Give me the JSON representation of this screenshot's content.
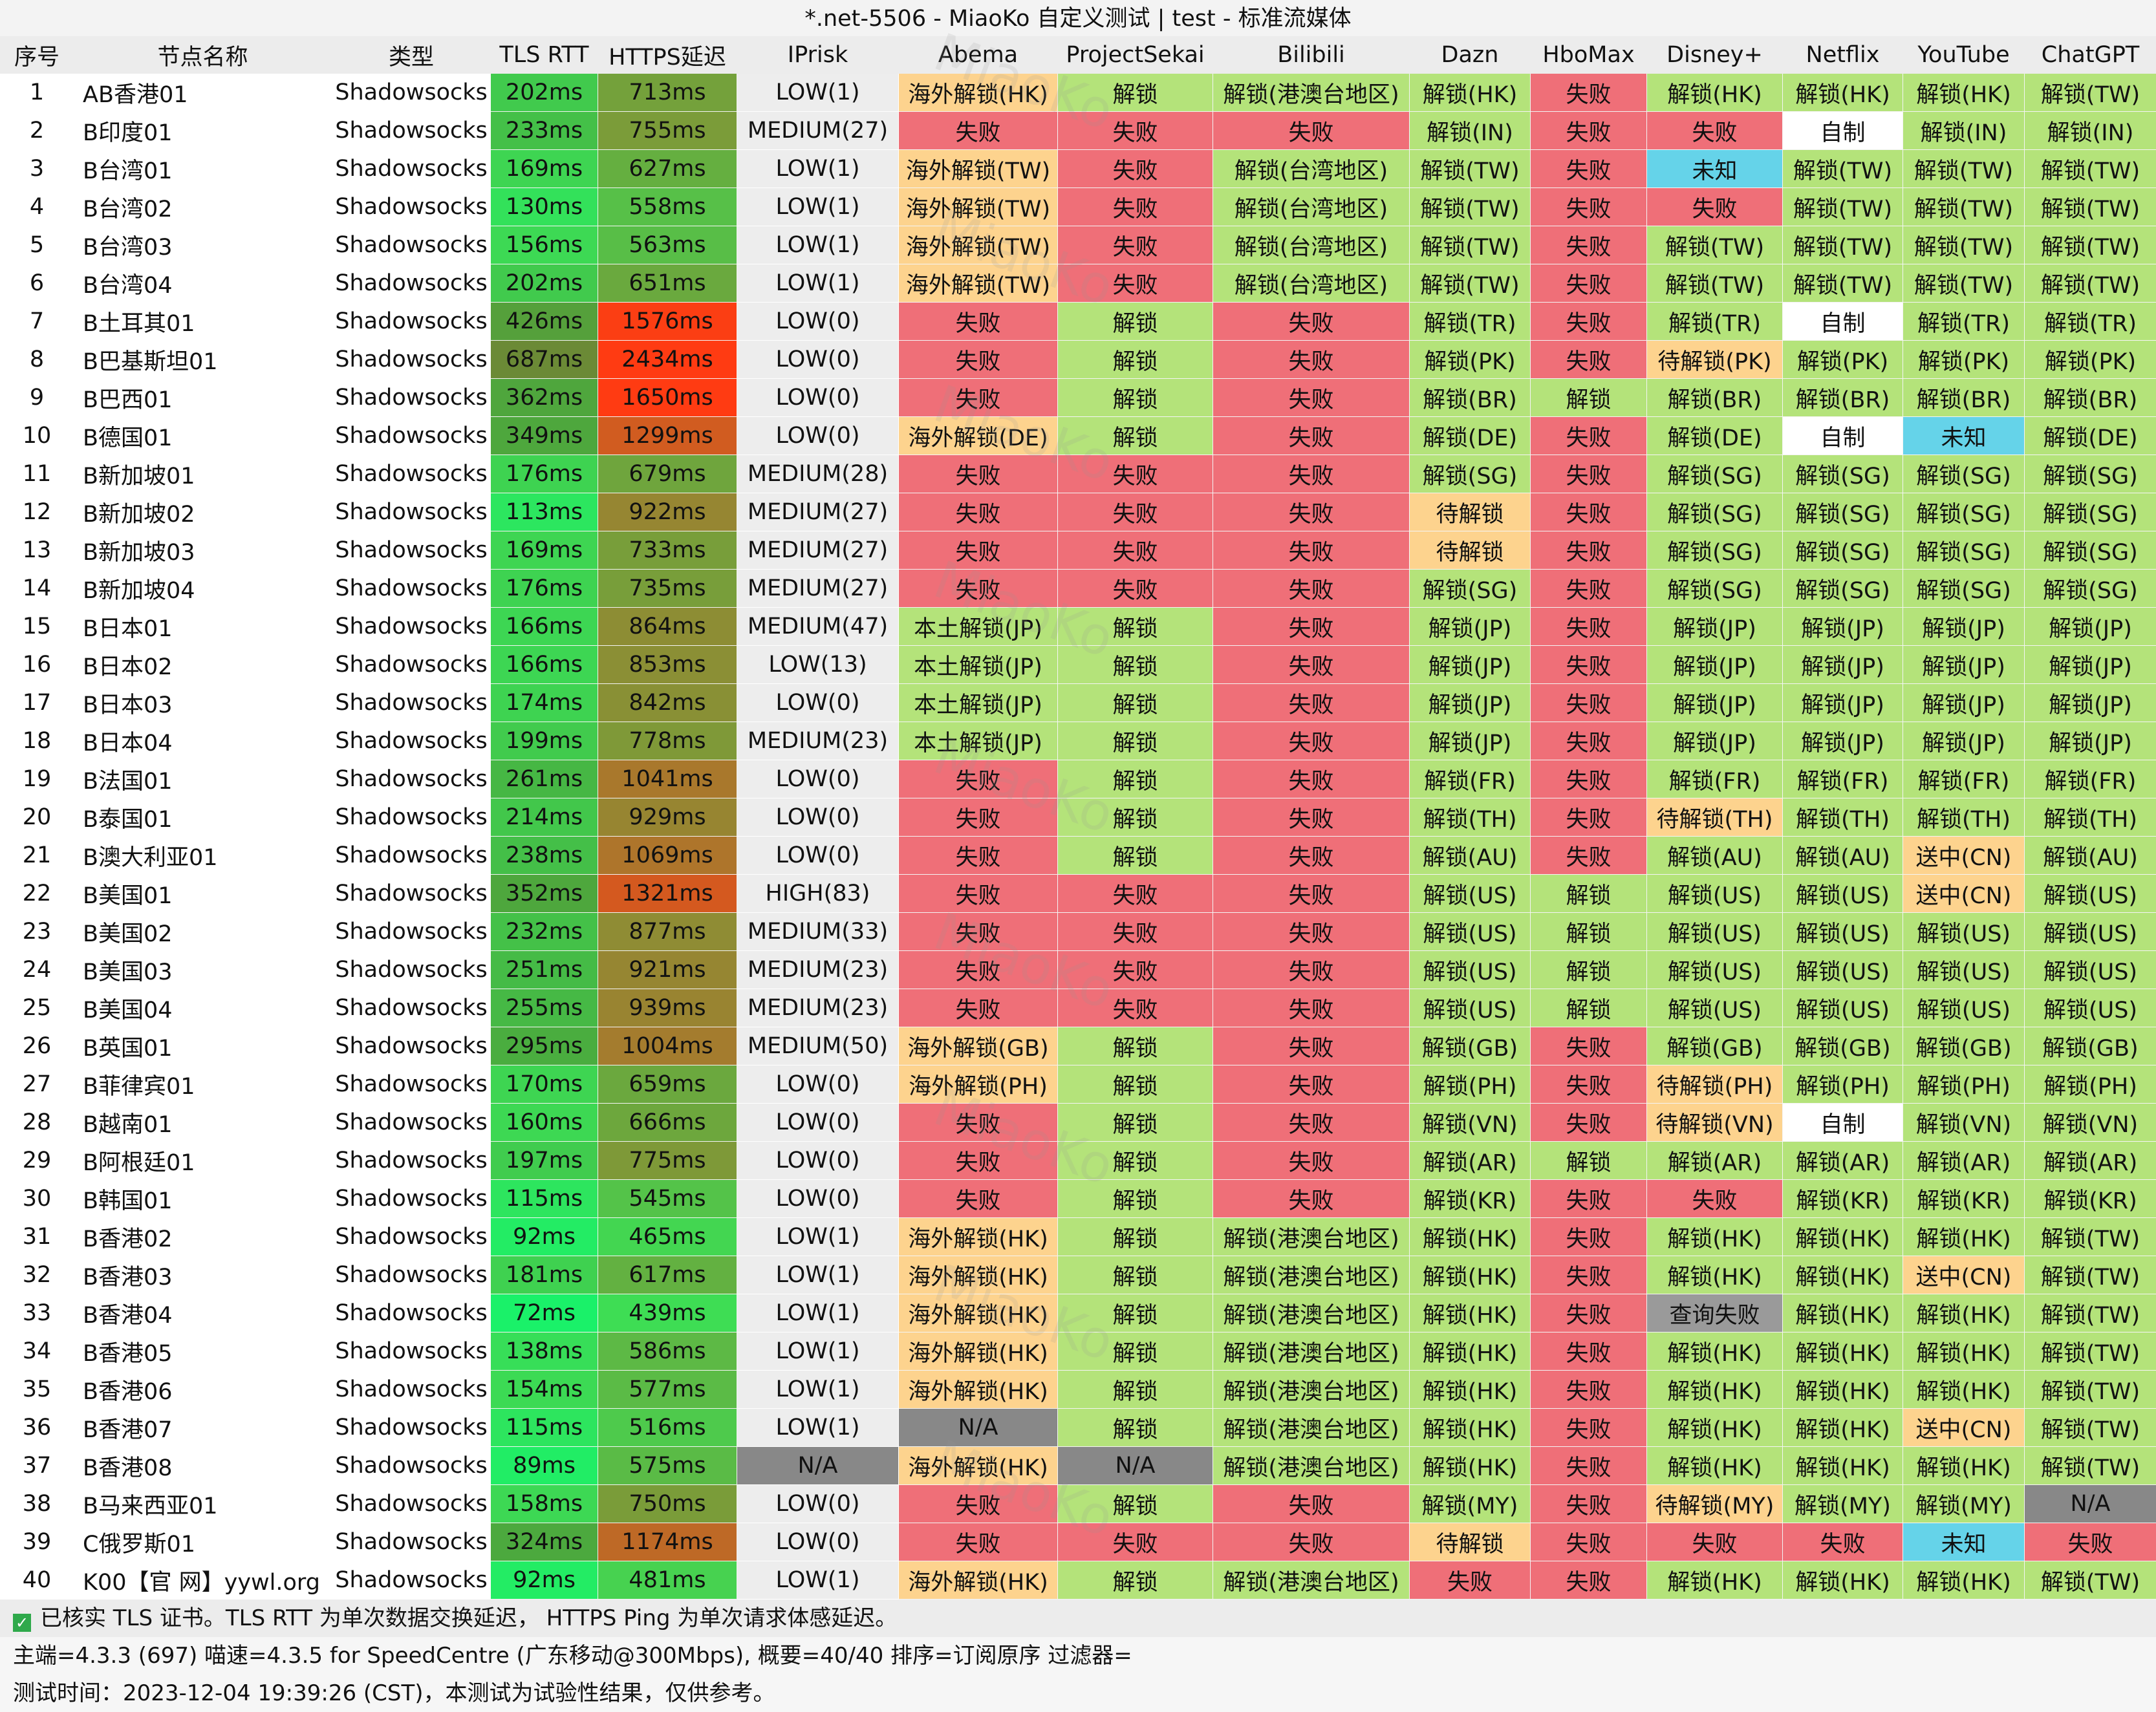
{
  "title": "*.net-5506 - MiaoKo 自定义测试 | test - 标准流媒体",
  "watermark": "MiaoKo",
  "headers": [
    "序号",
    "节点名称",
    "类型",
    "TLS RTT",
    "HTTPS延迟",
    "IPrisk",
    "Abema",
    "ProjectSekai",
    "Bilibili",
    "Dazn",
    "HboMax",
    "Disney+",
    "Netflix",
    "YouTube",
    "ChatGPT"
  ],
  "colors": {
    "unlock": "#b4e37a",
    "fail": "#ef6f78",
    "overseas": "#fdd38e",
    "pending": "#fdd38e",
    "unknown": "#65d3e9",
    "selfmade": "#ffffff",
    "na": "#888888",
    "query_fail": "#9a9a9a"
  },
  "rows": [
    [
      "1",
      "AB香港01",
      "Shadowsocks",
      "202ms",
      "713ms",
      "LOW(1)",
      "海外解锁(HK)",
      "解锁",
      "解锁(港澳台地区)",
      "解锁(HK)",
      "失败",
      "解锁(HK)",
      "解锁(HK)",
      "解锁(HK)",
      "解锁(TW)"
    ],
    [
      "2",
      "B印度01",
      "Shadowsocks",
      "233ms",
      "755ms",
      "MEDIUM(27)",
      "失败",
      "失败",
      "失败",
      "解锁(IN)",
      "失败",
      "失败",
      "自制",
      "解锁(IN)",
      "解锁(IN)"
    ],
    [
      "3",
      "B台湾01",
      "Shadowsocks",
      "169ms",
      "627ms",
      "LOW(1)",
      "海外解锁(TW)",
      "失败",
      "解锁(台湾地区)",
      "解锁(TW)",
      "失败",
      "未知",
      "解锁(TW)",
      "解锁(TW)",
      "解锁(TW)"
    ],
    [
      "4",
      "B台湾02",
      "Shadowsocks",
      "130ms",
      "558ms",
      "LOW(1)",
      "海外解锁(TW)",
      "失败",
      "解锁(台湾地区)",
      "解锁(TW)",
      "失败",
      "失败",
      "解锁(TW)",
      "解锁(TW)",
      "解锁(TW)"
    ],
    [
      "5",
      "B台湾03",
      "Shadowsocks",
      "156ms",
      "563ms",
      "LOW(1)",
      "海外解锁(TW)",
      "失败",
      "解锁(台湾地区)",
      "解锁(TW)",
      "失败",
      "解锁(TW)",
      "解锁(TW)",
      "解锁(TW)",
      "解锁(TW)"
    ],
    [
      "6",
      "B台湾04",
      "Shadowsocks",
      "202ms",
      "651ms",
      "LOW(1)",
      "海外解锁(TW)",
      "失败",
      "解锁(台湾地区)",
      "解锁(TW)",
      "失败",
      "解锁(TW)",
      "解锁(TW)",
      "解锁(TW)",
      "解锁(TW)"
    ],
    [
      "7",
      "B土耳其01",
      "Shadowsocks",
      "426ms",
      "1576ms",
      "LOW(0)",
      "失败",
      "解锁",
      "失败",
      "解锁(TR)",
      "失败",
      "解锁(TR)",
      "自制",
      "解锁(TR)",
      "解锁(TR)"
    ],
    [
      "8",
      "B巴基斯坦01",
      "Shadowsocks",
      "687ms",
      "2434ms",
      "LOW(0)",
      "失败",
      "解锁",
      "失败",
      "解锁(PK)",
      "失败",
      "待解锁(PK)",
      "解锁(PK)",
      "解锁(PK)",
      "解锁(PK)"
    ],
    [
      "9",
      "B巴西01",
      "Shadowsocks",
      "362ms",
      "1650ms",
      "LOW(0)",
      "失败",
      "解锁",
      "失败",
      "解锁(BR)",
      "解锁",
      "解锁(BR)",
      "解锁(BR)",
      "解锁(BR)",
      "解锁(BR)"
    ],
    [
      "10",
      "B德国01",
      "Shadowsocks",
      "349ms",
      "1299ms",
      "LOW(0)",
      "海外解锁(DE)",
      "解锁",
      "失败",
      "解锁(DE)",
      "失败",
      "解锁(DE)",
      "自制",
      "未知",
      "解锁(DE)"
    ],
    [
      "11",
      "B新加坡01",
      "Shadowsocks",
      "176ms",
      "679ms",
      "MEDIUM(28)",
      "失败",
      "失败",
      "失败",
      "解锁(SG)",
      "失败",
      "解锁(SG)",
      "解锁(SG)",
      "解锁(SG)",
      "解锁(SG)"
    ],
    [
      "12",
      "B新加坡02",
      "Shadowsocks",
      "113ms",
      "922ms",
      "MEDIUM(27)",
      "失败",
      "失败",
      "失败",
      "待解锁",
      "失败",
      "解锁(SG)",
      "解锁(SG)",
      "解锁(SG)",
      "解锁(SG)"
    ],
    [
      "13",
      "B新加坡03",
      "Shadowsocks",
      "169ms",
      "733ms",
      "MEDIUM(27)",
      "失败",
      "失败",
      "失败",
      "待解锁",
      "失败",
      "解锁(SG)",
      "解锁(SG)",
      "解锁(SG)",
      "解锁(SG)"
    ],
    [
      "14",
      "B新加坡04",
      "Shadowsocks",
      "176ms",
      "735ms",
      "MEDIUM(27)",
      "失败",
      "失败",
      "失败",
      "解锁(SG)",
      "失败",
      "解锁(SG)",
      "解锁(SG)",
      "解锁(SG)",
      "解锁(SG)"
    ],
    [
      "15",
      "B日本01",
      "Shadowsocks",
      "166ms",
      "864ms",
      "MEDIUM(47)",
      "本土解锁(JP)",
      "解锁",
      "失败",
      "解锁(JP)",
      "失败",
      "解锁(JP)",
      "解锁(JP)",
      "解锁(JP)",
      "解锁(JP)"
    ],
    [
      "16",
      "B日本02",
      "Shadowsocks",
      "166ms",
      "853ms",
      "LOW(13)",
      "本土解锁(JP)",
      "解锁",
      "失败",
      "解锁(JP)",
      "失败",
      "解锁(JP)",
      "解锁(JP)",
      "解锁(JP)",
      "解锁(JP)"
    ],
    [
      "17",
      "B日本03",
      "Shadowsocks",
      "174ms",
      "842ms",
      "LOW(0)",
      "本土解锁(JP)",
      "解锁",
      "失败",
      "解锁(JP)",
      "失败",
      "解锁(JP)",
      "解锁(JP)",
      "解锁(JP)",
      "解锁(JP)"
    ],
    [
      "18",
      "B日本04",
      "Shadowsocks",
      "199ms",
      "778ms",
      "MEDIUM(23)",
      "本土解锁(JP)",
      "解锁",
      "失败",
      "解锁(JP)",
      "失败",
      "解锁(JP)",
      "解锁(JP)",
      "解锁(JP)",
      "解锁(JP)"
    ],
    [
      "19",
      "B法国01",
      "Shadowsocks",
      "261ms",
      "1041ms",
      "LOW(0)",
      "失败",
      "解锁",
      "失败",
      "解锁(FR)",
      "失败",
      "解锁(FR)",
      "解锁(FR)",
      "解锁(FR)",
      "解锁(FR)"
    ],
    [
      "20",
      "B泰国01",
      "Shadowsocks",
      "214ms",
      "929ms",
      "LOW(0)",
      "失败",
      "解锁",
      "失败",
      "解锁(TH)",
      "失败",
      "待解锁(TH)",
      "解锁(TH)",
      "解锁(TH)",
      "解锁(TH)"
    ],
    [
      "21",
      "B澳大利亚01",
      "Shadowsocks",
      "238ms",
      "1069ms",
      "LOW(0)",
      "失败",
      "解锁",
      "失败",
      "解锁(AU)",
      "失败",
      "解锁(AU)",
      "解锁(AU)",
      "送中(CN)",
      "解锁(AU)"
    ],
    [
      "22",
      "B美国01",
      "Shadowsocks",
      "352ms",
      "1321ms",
      "HIGH(83)",
      "失败",
      "失败",
      "失败",
      "解锁(US)",
      "解锁",
      "解锁(US)",
      "解锁(US)",
      "送中(CN)",
      "解锁(US)"
    ],
    [
      "23",
      "B美国02",
      "Shadowsocks",
      "232ms",
      "877ms",
      "MEDIUM(33)",
      "失败",
      "失败",
      "失败",
      "解锁(US)",
      "解锁",
      "解锁(US)",
      "解锁(US)",
      "解锁(US)",
      "解锁(US)"
    ],
    [
      "24",
      "B美国03",
      "Shadowsocks",
      "251ms",
      "921ms",
      "MEDIUM(23)",
      "失败",
      "失败",
      "失败",
      "解锁(US)",
      "解锁",
      "解锁(US)",
      "解锁(US)",
      "解锁(US)",
      "解锁(US)"
    ],
    [
      "25",
      "B美国04",
      "Shadowsocks",
      "255ms",
      "939ms",
      "MEDIUM(23)",
      "失败",
      "失败",
      "失败",
      "解锁(US)",
      "解锁",
      "解锁(US)",
      "解锁(US)",
      "解锁(US)",
      "解锁(US)"
    ],
    [
      "26",
      "B英国01",
      "Shadowsocks",
      "295ms",
      "1004ms",
      "MEDIUM(50)",
      "海外解锁(GB)",
      "解锁",
      "失败",
      "解锁(GB)",
      "失败",
      "解锁(GB)",
      "解锁(GB)",
      "解锁(GB)",
      "解锁(GB)"
    ],
    [
      "27",
      "B菲律宾01",
      "Shadowsocks",
      "170ms",
      "659ms",
      "LOW(0)",
      "海外解锁(PH)",
      "解锁",
      "失败",
      "解锁(PH)",
      "失败",
      "待解锁(PH)",
      "解锁(PH)",
      "解锁(PH)",
      "解锁(PH)"
    ],
    [
      "28",
      "B越南01",
      "Shadowsocks",
      "160ms",
      "666ms",
      "LOW(0)",
      "失败",
      "解锁",
      "失败",
      "解锁(VN)",
      "失败",
      "待解锁(VN)",
      "自制",
      "解锁(VN)",
      "解锁(VN)"
    ],
    [
      "29",
      "B阿根廷01",
      "Shadowsocks",
      "197ms",
      "775ms",
      "LOW(0)",
      "失败",
      "解锁",
      "失败",
      "解锁(AR)",
      "解锁",
      "解锁(AR)",
      "解锁(AR)",
      "解锁(AR)",
      "解锁(AR)"
    ],
    [
      "30",
      "B韩国01",
      "Shadowsocks",
      "115ms",
      "545ms",
      "LOW(0)",
      "失败",
      "解锁",
      "失败",
      "解锁(KR)",
      "失败",
      "失败",
      "解锁(KR)",
      "解锁(KR)",
      "解锁(KR)"
    ],
    [
      "31",
      "B香港02",
      "Shadowsocks",
      "92ms",
      "465ms",
      "LOW(1)",
      "海外解锁(HK)",
      "解锁",
      "解锁(港澳台地区)",
      "解锁(HK)",
      "失败",
      "解锁(HK)",
      "解锁(HK)",
      "解锁(HK)",
      "解锁(TW)"
    ],
    [
      "32",
      "B香港03",
      "Shadowsocks",
      "181ms",
      "617ms",
      "LOW(1)",
      "海外解锁(HK)",
      "解锁",
      "解锁(港澳台地区)",
      "解锁(HK)",
      "失败",
      "解锁(HK)",
      "解锁(HK)",
      "送中(CN)",
      "解锁(TW)"
    ],
    [
      "33",
      "B香港04",
      "Shadowsocks",
      "72ms",
      "439ms",
      "LOW(1)",
      "海外解锁(HK)",
      "解锁",
      "解锁(港澳台地区)",
      "解锁(HK)",
      "失败",
      "查询失败",
      "解锁(HK)",
      "解锁(HK)",
      "解锁(TW)"
    ],
    [
      "34",
      "B香港05",
      "Shadowsocks",
      "138ms",
      "586ms",
      "LOW(1)",
      "海外解锁(HK)",
      "解锁",
      "解锁(港澳台地区)",
      "解锁(HK)",
      "失败",
      "解锁(HK)",
      "解锁(HK)",
      "解锁(HK)",
      "解锁(TW)"
    ],
    [
      "35",
      "B香港06",
      "Shadowsocks",
      "154ms",
      "577ms",
      "LOW(1)",
      "海外解锁(HK)",
      "解锁",
      "解锁(港澳台地区)",
      "解锁(HK)",
      "失败",
      "解锁(HK)",
      "解锁(HK)",
      "解锁(HK)",
      "解锁(TW)"
    ],
    [
      "36",
      "B香港07",
      "Shadowsocks",
      "115ms",
      "516ms",
      "LOW(1)",
      "N/A",
      "解锁",
      "解锁(港澳台地区)",
      "解锁(HK)",
      "失败",
      "解锁(HK)",
      "解锁(HK)",
      "送中(CN)",
      "解锁(TW)"
    ],
    [
      "37",
      "B香港08",
      "Shadowsocks",
      "89ms",
      "575ms",
      "N/A",
      "海外解锁(HK)",
      "N/A",
      "解锁(港澳台地区)",
      "解锁(HK)",
      "失败",
      "解锁(HK)",
      "解锁(HK)",
      "解锁(HK)",
      "解锁(TW)"
    ],
    [
      "38",
      "B马来西亚01",
      "Shadowsocks",
      "158ms",
      "750ms",
      "LOW(0)",
      "失败",
      "解锁",
      "失败",
      "解锁(MY)",
      "失败",
      "待解锁(MY)",
      "解锁(MY)",
      "解锁(MY)",
      "N/A"
    ],
    [
      "39",
      "C俄罗斯01",
      "Shadowsocks",
      "324ms",
      "1174ms",
      "LOW(0)",
      "失败",
      "失败",
      "失败",
      "待解锁",
      "失败",
      "失败",
      "失败",
      "未知",
      "失败"
    ],
    [
      "40",
      "K00【官 网】yywl.org",
      "Shadowsocks",
      "92ms",
      "481ms",
      "LOW(1)",
      "海外解锁(HK)",
      "解锁",
      "解锁(港澳台地区)",
      "失败",
      "失败",
      "解锁(HK)",
      "解锁(HK)",
      "解锁(HK)",
      "解锁(TW)"
    ]
  ],
  "footer": {
    "line1": "已核实 TLS 证书。TLS RTT 为单次数据交换延迟， HTTPS Ping 为单次请求体感延迟。",
    "line2": "主端=4.3.3 (697) 喵速=4.3.5 for SpeedCentre (广东移动@300Mbps), 概要=40/40 排序=订阅原序 过滤器=",
    "line3": "测试时间：2023-12-04 19:39:26 (CST)，本测试为试验性结果，仅供参考。"
  }
}
